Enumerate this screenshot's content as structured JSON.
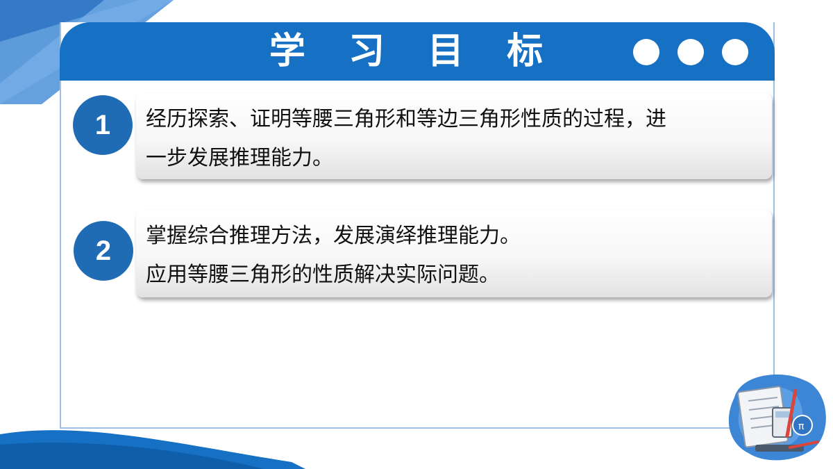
{
  "header": {
    "title": "学 习 目 标"
  },
  "objectives": [
    {
      "number": "1",
      "lines": [
        "经历探索、证明等腰三角形和等边三角形性质的过程，进",
        "一步发展推理能力。"
      ]
    },
    {
      "number": "2",
      "lines": [
        "掌握综合推理方法，发展演绎推理能力。",
        "应用等腰三角形的性质解决实际问题。"
      ]
    }
  ],
  "colors": {
    "header_blue": "#1670c4",
    "badge_blue": "#1f6cb5",
    "frame_border": "#9bbfe6"
  },
  "icons": [
    "header-dot-icon",
    "math-study-illustration"
  ]
}
